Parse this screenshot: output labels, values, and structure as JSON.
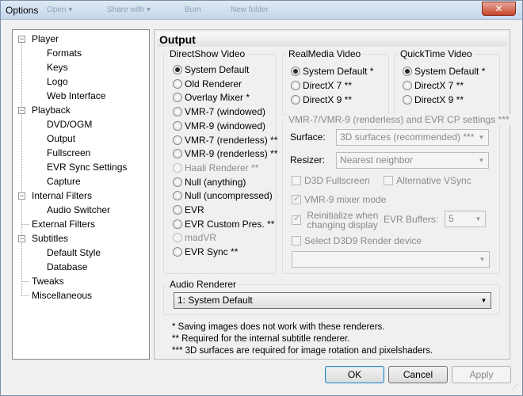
{
  "window": {
    "title": "Options",
    "close_glyph": "✕",
    "ghost_menu": [
      "Open ▾",
      "Share with ▾",
      "Burn",
      "New folder"
    ]
  },
  "tree": [
    {
      "label": "Player",
      "level": 0,
      "expander": "−"
    },
    {
      "label": "Formats",
      "level": 1
    },
    {
      "label": "Keys",
      "level": 1
    },
    {
      "label": "Logo",
      "level": 1
    },
    {
      "label": "Web Interface",
      "level": 1
    },
    {
      "label": "Playback",
      "level": 0,
      "expander": "−"
    },
    {
      "label": "DVD/OGM",
      "level": 1
    },
    {
      "label": "Output",
      "level": 1,
      "selected": true
    },
    {
      "label": "Fullscreen",
      "level": 1
    },
    {
      "label": "EVR Sync Settings",
      "level": 1
    },
    {
      "label": "Capture",
      "level": 1
    },
    {
      "label": "Internal Filters",
      "level": 0,
      "expander": "−"
    },
    {
      "label": "Audio Switcher",
      "level": 1
    },
    {
      "label": "External Filters",
      "level": 0
    },
    {
      "label": "Subtitles",
      "level": 0,
      "expander": "−"
    },
    {
      "label": "Default Style",
      "level": 1
    },
    {
      "label": "Database",
      "level": 1
    },
    {
      "label": "Tweaks",
      "level": 0
    },
    {
      "label": "Miscellaneous",
      "level": 0
    }
  ],
  "panel": {
    "title": "Output"
  },
  "directshow": {
    "title": "DirectShow Video",
    "options": [
      {
        "label": "System Default",
        "checked": true
      },
      {
        "label": "Old Renderer"
      },
      {
        "label": "Overlay Mixer *"
      },
      {
        "label": "VMR-7 (windowed)"
      },
      {
        "label": "VMR-9 (windowed)"
      },
      {
        "label": "VMR-7 (renderless) **"
      },
      {
        "label": "VMR-9 (renderless) **"
      },
      {
        "label": "Haali Renderer **",
        "disabled": true
      },
      {
        "label": "Null (anything)"
      },
      {
        "label": "Null (uncompressed)"
      },
      {
        "label": "EVR"
      },
      {
        "label": "EVR Custom Pres. **"
      },
      {
        "label": "madVR",
        "disabled": true
      },
      {
        "label": "EVR Sync **"
      }
    ]
  },
  "realmedia": {
    "title": "RealMedia Video",
    "options": [
      {
        "label": "System Default *",
        "checked": true
      },
      {
        "label": "DirectX 7 **"
      },
      {
        "label": "DirectX 9 **"
      }
    ]
  },
  "quicktime": {
    "title": "QuickTime Video",
    "options": [
      {
        "label": "System Default *",
        "checked": true
      },
      {
        "label": "DirectX 7 **"
      },
      {
        "label": "DirectX 9 **"
      }
    ]
  },
  "vmr": {
    "title": "VMR-7/VMR-9 (renderless) and EVR CP settings ***",
    "surface_label": "Surface:",
    "surface_value": "3D surfaces (recommended) ***",
    "resizer_label": "Resizer:",
    "resizer_value": "Nearest neighbor",
    "d3d_fullscreen": "D3D Fullscreen",
    "alt_vsync": "Alternative VSync",
    "vmr9_mixer": "VMR-9 mixer mode",
    "reinit_line1": "Reinitialize when",
    "reinit_line2": "changing display",
    "evr_buffers_label": "EVR Buffers:",
    "evr_buffers_value": "5",
    "select_d3d9": "Select D3D9 Render device",
    "device_value": ""
  },
  "audio": {
    "title": "Audio Renderer",
    "value": "1: System Default"
  },
  "footnotes": [
    "* Saving images does not work with these renderers.",
    "** Required for the internal subtitle renderer.",
    "*** 3D surfaces are required for image rotation and pixelshaders."
  ],
  "buttons": {
    "ok": "OK",
    "cancel": "Cancel",
    "apply": "Apply"
  }
}
